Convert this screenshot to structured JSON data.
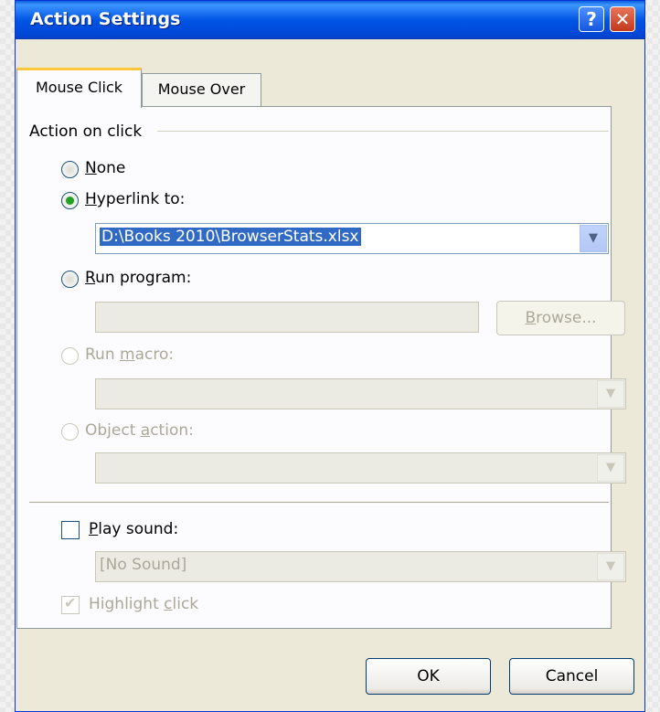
{
  "window": {
    "title": "Action Settings",
    "help_glyph": "?",
    "close_glyph": "✕"
  },
  "tabs": [
    {
      "label": "Mouse Click",
      "active": true
    },
    {
      "label": "Mouse Over",
      "active": false
    }
  ],
  "group_title": "Action on click",
  "options": {
    "none": {
      "prefix": "",
      "accel": "N",
      "rest": "one"
    },
    "hyperlink": {
      "prefix": "",
      "accel": "H",
      "rest": "yperlink to:"
    },
    "run_program": {
      "prefix": "",
      "accel": "R",
      "rest": "un program:"
    },
    "run_macro": {
      "prefix": "Run ",
      "accel": "m",
      "rest": "acro:"
    },
    "object_action": {
      "prefix": "Object ",
      "accel": "a",
      "rest": "ction:"
    }
  },
  "hyperlink_value": "D:\\Books 2010\\BrowserStats.xlsx",
  "browse_button": {
    "accel": "B",
    "rest": "rowse..."
  },
  "play_sound": {
    "accel": "P",
    "rest": "lay sound:"
  },
  "sound_value": "[No Sound]",
  "highlight_click": {
    "prefix": "Highlight ",
    "accel": "c",
    "rest": "lick",
    "checked": true
  },
  "buttons": {
    "ok": "OK",
    "cancel": "Cancel"
  },
  "colors": {
    "title_bar": "#0055e5",
    "selection": "#316ac5",
    "radio_dot": "#21a121"
  }
}
